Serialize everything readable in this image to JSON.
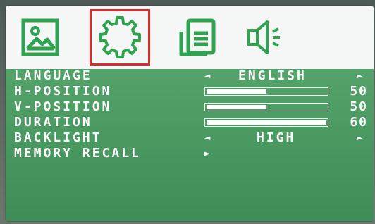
{
  "colors": {
    "accent_active": "#d62d2d",
    "menu_green": "#4a9a62",
    "icon_green": "#2fa350",
    "text": "#ffffff"
  },
  "tabs": [
    {
      "icon": "picture-icon",
      "selected": false
    },
    {
      "icon": "gear-icon",
      "selected": true
    },
    {
      "icon": "document-icon",
      "selected": false
    },
    {
      "icon": "speaker-icon",
      "selected": false
    }
  ],
  "menu": {
    "language": {
      "label": "LANGUAGE",
      "value": "ENGLISH"
    },
    "hposition": {
      "label": "H-POSITION",
      "value": "50",
      "level": 0.5
    },
    "vposition": {
      "label": "V-POSITION",
      "value": "50",
      "level": 0.5
    },
    "duration": {
      "label": "DURATION",
      "value": "60",
      "level": 1.0
    },
    "backlight": {
      "label": "BACKLIGHT",
      "value": "HIGH"
    },
    "memory_recall": {
      "label": "MEMORY RECALL"
    }
  }
}
